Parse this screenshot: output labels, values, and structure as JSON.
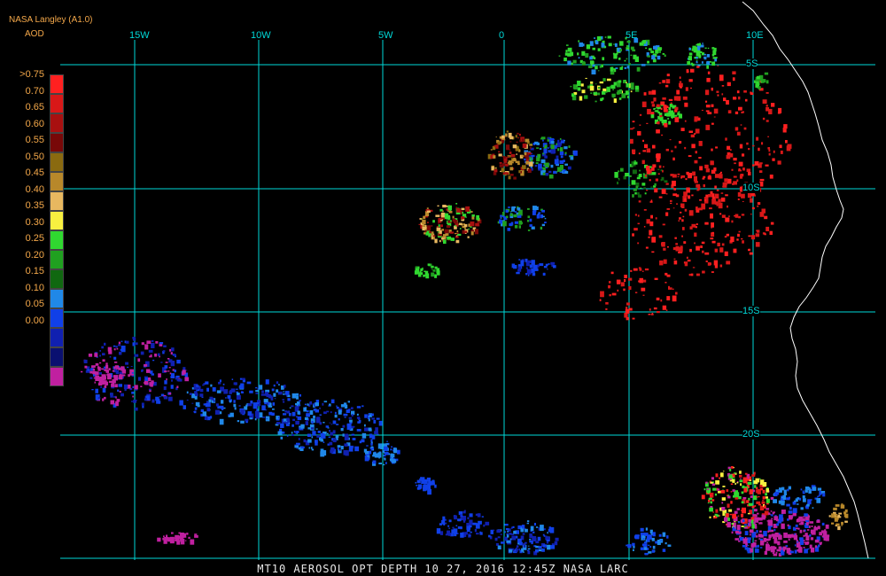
{
  "header": {
    "source": "NASA Langley (A1.0)",
    "product_label": "AOD"
  },
  "legend": {
    "labels": [
      ">0.75",
      "0.70",
      "0.65",
      "0.60",
      "0.55",
      "0.50",
      "0.45",
      "0.40",
      "0.35",
      "0.30",
      "0.25",
      "0.20",
      "0.15",
      "0.10",
      "0.05",
      "0.00"
    ],
    "colors": [
      "#ff2020",
      "#d81818",
      "#a81010",
      "#780808",
      "#8a6a10",
      "#b8882a",
      "#e8b860",
      "#f8f040",
      "#30d830",
      "#20a020",
      "#106810",
      "#2088e8",
      "#1040e8",
      "#1020b0",
      "#0a1070",
      "#c020a0"
    ]
  },
  "grid": {
    "longitudes": [
      "15W",
      "10W",
      "5W",
      "0",
      "5E",
      "10E"
    ],
    "latitudes": [
      "5S",
      "10S",
      "15S",
      "20S"
    ]
  },
  "palette": {
    "grid_color": "#00d8d8",
    "coast_color": "#ffffff",
    "label_color": "#f4a84a"
  },
  "footer": {
    "caption": "MT10  AEROSOL OPT DEPTH   10 27, 2016 12:45Z   NASA LARC"
  }
}
